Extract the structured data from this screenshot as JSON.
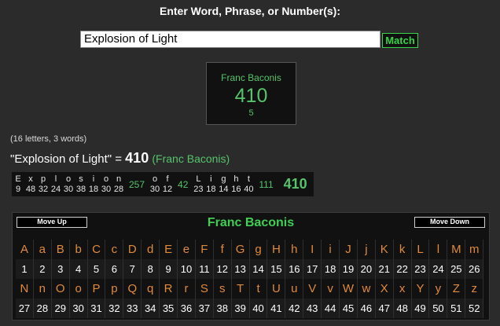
{
  "header": {
    "prompt": "Enter Word, Phrase, or Number(s):"
  },
  "search": {
    "value": "Explosion of Light",
    "match_label": "Match"
  },
  "result_box": {
    "cipher": "Franc Baconis",
    "total": "410",
    "reduced": "5"
  },
  "stats": "(16 letters, 3 words)",
  "phrase_result": {
    "phrase": "\"Explosion of Light\"",
    "equals": " = ",
    "value": "410",
    "cipher": "(Franc Baconis)"
  },
  "breakdown": {
    "words": [
      {
        "letters": [
          [
            "E",
            "9"
          ],
          [
            "x",
            "48"
          ],
          [
            "p",
            "32"
          ],
          [
            "l",
            "24"
          ],
          [
            "o",
            "30"
          ],
          [
            "s",
            "38"
          ],
          [
            "i",
            "18"
          ],
          [
            "o",
            "30"
          ],
          [
            "n",
            "28"
          ]
        ],
        "sum": "257"
      },
      {
        "letters": [
          [
            "o",
            "30"
          ],
          [
            "f",
            "12"
          ]
        ],
        "sum": "42"
      },
      {
        "letters": [
          [
            "L",
            "23"
          ],
          [
            "i",
            "18"
          ],
          [
            "g",
            "14"
          ],
          [
            "h",
            "16"
          ],
          [
            "t",
            "40"
          ]
        ],
        "sum": "111"
      }
    ],
    "total": "410"
  },
  "cipher_table": {
    "title": "Franc Baconis",
    "move_up": "Move Up",
    "move_down": "Move Down",
    "rows": [
      [
        "A",
        "a",
        "B",
        "b",
        "C",
        "c",
        "D",
        "d",
        "E",
        "e",
        "F",
        "f",
        "G",
        "g",
        "H",
        "h",
        "I",
        "i",
        "J",
        "j",
        "K",
        "k",
        "L",
        "l",
        "M",
        "m"
      ],
      [
        "1",
        "2",
        "3",
        "4",
        "5",
        "6",
        "7",
        "8",
        "9",
        "10",
        "11",
        "12",
        "13",
        "14",
        "15",
        "16",
        "17",
        "18",
        "19",
        "20",
        "21",
        "22",
        "23",
        "24",
        "25",
        "26"
      ],
      [
        "N",
        "n",
        "O",
        "o",
        "P",
        "p",
        "Q",
        "q",
        "R",
        "r",
        "S",
        "s",
        "T",
        "t",
        "U",
        "u",
        "V",
        "v",
        "W",
        "w",
        "X",
        "x",
        "Y",
        "y",
        "Z",
        "z"
      ],
      [
        "27",
        "28",
        "29",
        "30",
        "31",
        "32",
        "33",
        "34",
        "35",
        "36",
        "37",
        "38",
        "39",
        "40",
        "41",
        "42",
        "43",
        "44",
        "45",
        "46",
        "47",
        "48",
        "49",
        "50",
        "51",
        "52"
      ]
    ]
  }
}
